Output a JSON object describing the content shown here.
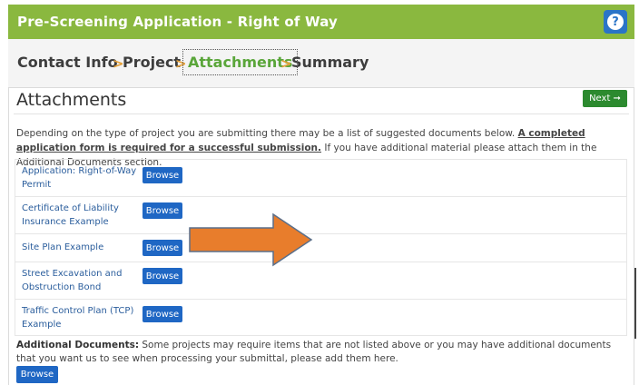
{
  "header": {
    "title": "Pre-Screening Application - Right of Way",
    "help_label": "?"
  },
  "steps": {
    "items": [
      "Contact Info",
      "Project",
      "Attachments",
      "Summary"
    ],
    "separator": ">",
    "active": "Attachments"
  },
  "section": {
    "title": "Attachments",
    "next_label": "Next ➞"
  },
  "intro": {
    "text_before": "Depending on the type of project you are submitting there may be a list of suggested documents below. ",
    "emphasis": "A completed application form is required for a successful submission.",
    "text_after": " If you have additional material please attach them in the Additional Documents section."
  },
  "documents": {
    "browse_label": "Browse",
    "items": [
      "Application: Right-of-Way Permit",
      "Certificate of Liability Insurance Example",
      "Site Plan Example",
      "Street Excavation and Obstruction Bond",
      "Traffic Control Plan (TCP) Example"
    ]
  },
  "additional": {
    "label": "Additional Documents:",
    "text": " Some projects may require items that are not listed above or you may have additional documents that you want us to see when processing your submittal, please add them here.",
    "browse_label": "Browse"
  },
  "colors": {
    "header_green": "#8ab83f",
    "active_step": "#5aa63a",
    "step_separator": "#e5a13a",
    "next_button": "#2c8a2f",
    "browse_button": "#1f67c4",
    "arrow_fill": "#e87d2c"
  }
}
